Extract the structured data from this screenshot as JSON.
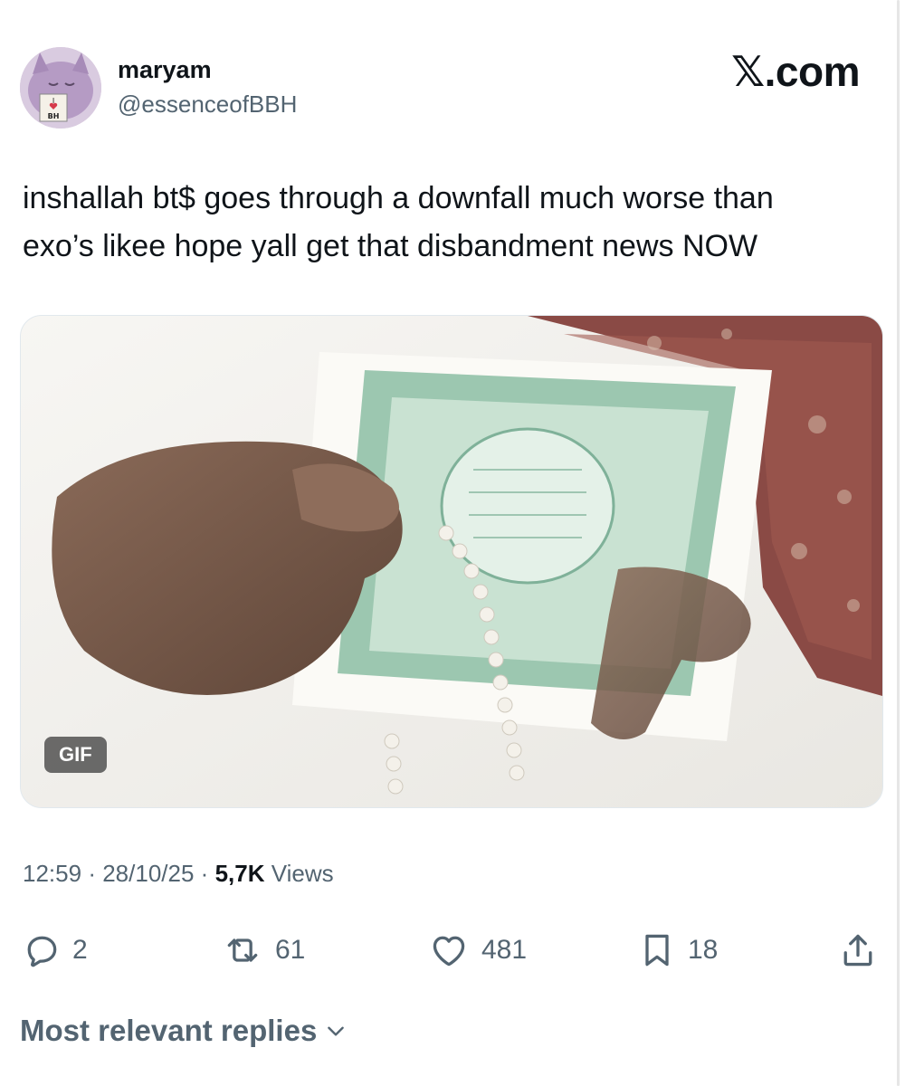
{
  "tweet": {
    "author_name": "maryam",
    "author_handle": "@essenceofBBH",
    "brand": "𝕏.com",
    "text_line1": "inshallah bt$ goes through a downfall much worse than",
    "text_line2": "exo’s likee hope yall get that disbandment news NOW",
    "media": {
      "badge": "GIF",
      "kind": "animated-gif"
    },
    "time": "12:59",
    "date": "28/10/25",
    "views_count": "5,7K",
    "views_label": "Views",
    "separator": "·"
  },
  "avatar": {
    "sticker_line1": "I",
    "sticker_line2": "BH"
  },
  "actions": [
    {
      "icon": "reply-icon",
      "count": "2"
    },
    {
      "icon": "repost-icon",
      "count": "61"
    },
    {
      "icon": "like-icon",
      "count": "481"
    },
    {
      "icon": "bookmark-icon",
      "count": "18"
    },
    {
      "icon": "share-icon",
      "count": ""
    }
  ],
  "replies_sort": {
    "label": "Most relevant replies",
    "icon": "chevron-down-icon"
  },
  "colors": {
    "text": "#0f1419",
    "secondary": "#536471",
    "border": "#e1e8ed",
    "badge": "#3c3c3c"
  }
}
